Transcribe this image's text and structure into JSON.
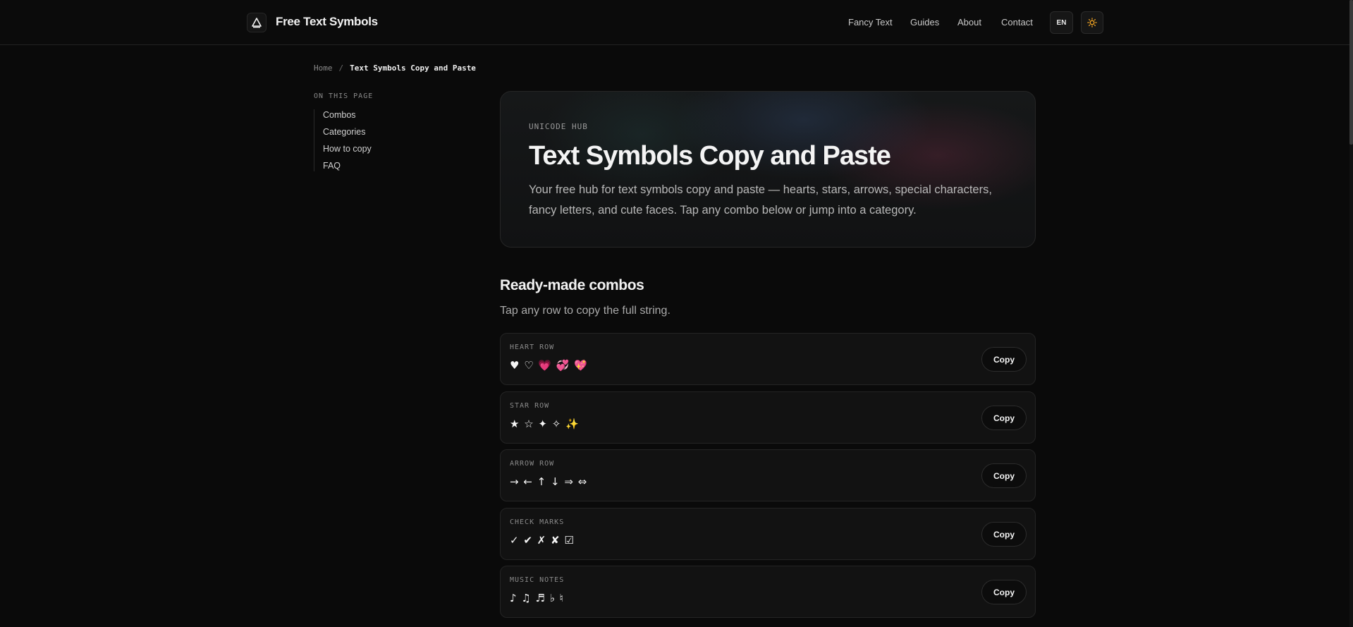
{
  "header": {
    "brand": "Free Text Symbols",
    "nav": [
      "Fancy Text",
      "Guides",
      "About",
      "Contact"
    ],
    "lang": "EN"
  },
  "breadcrumb": {
    "home": "Home",
    "separator": "/",
    "current": "Text Symbols Copy and Paste"
  },
  "toc": {
    "title": "ON THIS PAGE",
    "items": [
      "Combos",
      "Categories",
      "How to copy",
      "FAQ"
    ]
  },
  "hero": {
    "kicker": "UNICODE HUB",
    "title": "Text Symbols Copy and Paste",
    "description": "Your free hub for text symbols copy and paste — hearts, stars, arrows, special characters, fancy letters, and cute faces. Tap any combo below or jump into a category."
  },
  "combos": {
    "title": "Ready-made combos",
    "subtitle": "Tap any row to copy the full string.",
    "copy_label": "Copy",
    "rows": [
      {
        "label": "HEART ROW",
        "symbols": "♥ ♡ 💗 💞 💖"
      },
      {
        "label": "STAR ROW",
        "symbols": "★ ☆ ✦ ✧ ✨"
      },
      {
        "label": "ARROW ROW",
        "symbols": "→ ← ↑ ↓ ⇒ ⇔"
      },
      {
        "label": "CHECK MARKS",
        "symbols": "✓ ✔ ✗ ✘ ☑"
      },
      {
        "label": "MUSIC NOTES",
        "symbols": "♪ ♫ ♬ ♭ ♮"
      }
    ]
  },
  "colors": {
    "background": "#0a0a0a",
    "accent_sun": "#f5a623"
  }
}
